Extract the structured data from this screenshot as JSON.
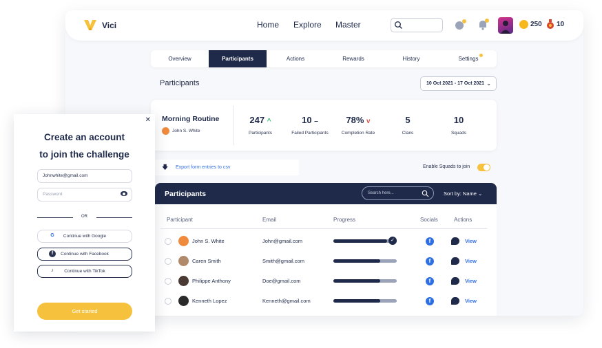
{
  "app": {
    "brand": "Vici",
    "nav": [
      "Home",
      "Explore",
      "Master"
    ],
    "coins": "250",
    "potions": "10"
  },
  "tabs": [
    "Overview",
    "Participants",
    "Actions",
    "Rewards",
    "History",
    "Settings"
  ],
  "active_tab": "Participants",
  "section_title": "Participants",
  "date_range": "10 Oct 2021 - 17 Oct 2021",
  "routine": {
    "title": "Morning Routine",
    "owner": "John S. White"
  },
  "stats": [
    {
      "value": "247",
      "label": "Participants",
      "trend": "^"
    },
    {
      "value": "10",
      "label": "Failed Participants",
      "trend": "–"
    },
    {
      "value": "78%",
      "label": "Completion Rate",
      "trend": "v"
    },
    {
      "value": "5",
      "label": "Clans",
      "trend": ""
    },
    {
      "value": "10",
      "label": "Squads",
      "trend": ""
    }
  ],
  "export_label": "Export form entries to csv",
  "squads_toggle": {
    "label": "Enable Squads to join",
    "on": true
  },
  "table": {
    "title": "Participants",
    "search_placeholder": "Search here...",
    "sort_label": "Sort by: Name",
    "columns": [
      "Participant",
      "Email",
      "Progress",
      "Socials",
      "Actions"
    ],
    "rows": [
      {
        "name": "John S. White",
        "email": "John@gmail.com",
        "progress": 1.0,
        "complete": true,
        "action": "View",
        "avatar_color": "#f08a3c"
      },
      {
        "name": "Caren Smith",
        "email": "Smith@gmail.com",
        "progress": 0.74,
        "complete": false,
        "action": "View",
        "avatar_color": "#b08a6a"
      },
      {
        "name": "Philippe Anthony",
        "email": "Doe@gmail.com",
        "progress": 0.74,
        "complete": false,
        "action": "View",
        "avatar_color": "#4a3a34"
      },
      {
        "name": "Kenneth Lopez",
        "email": "Kenneth@gmail.com",
        "progress": 0.74,
        "complete": false,
        "action": "View",
        "avatar_color": "#2a2a2a"
      }
    ]
  },
  "signup": {
    "title_line1": "Create an account",
    "title_line2": "to join the challenge",
    "email_value": "Johnwhite@gmail.com",
    "password_placeholder": "Password",
    "or": "OR",
    "google": "Continue with Google",
    "facebook": "Continue with Facebook",
    "tiktok": "Continue with TikTok",
    "cta": "Get started"
  },
  "colors": {
    "navy": "#1f2a4a",
    "accent_yellow": "#f6c23e",
    "link_blue": "#2f6fe4"
  }
}
